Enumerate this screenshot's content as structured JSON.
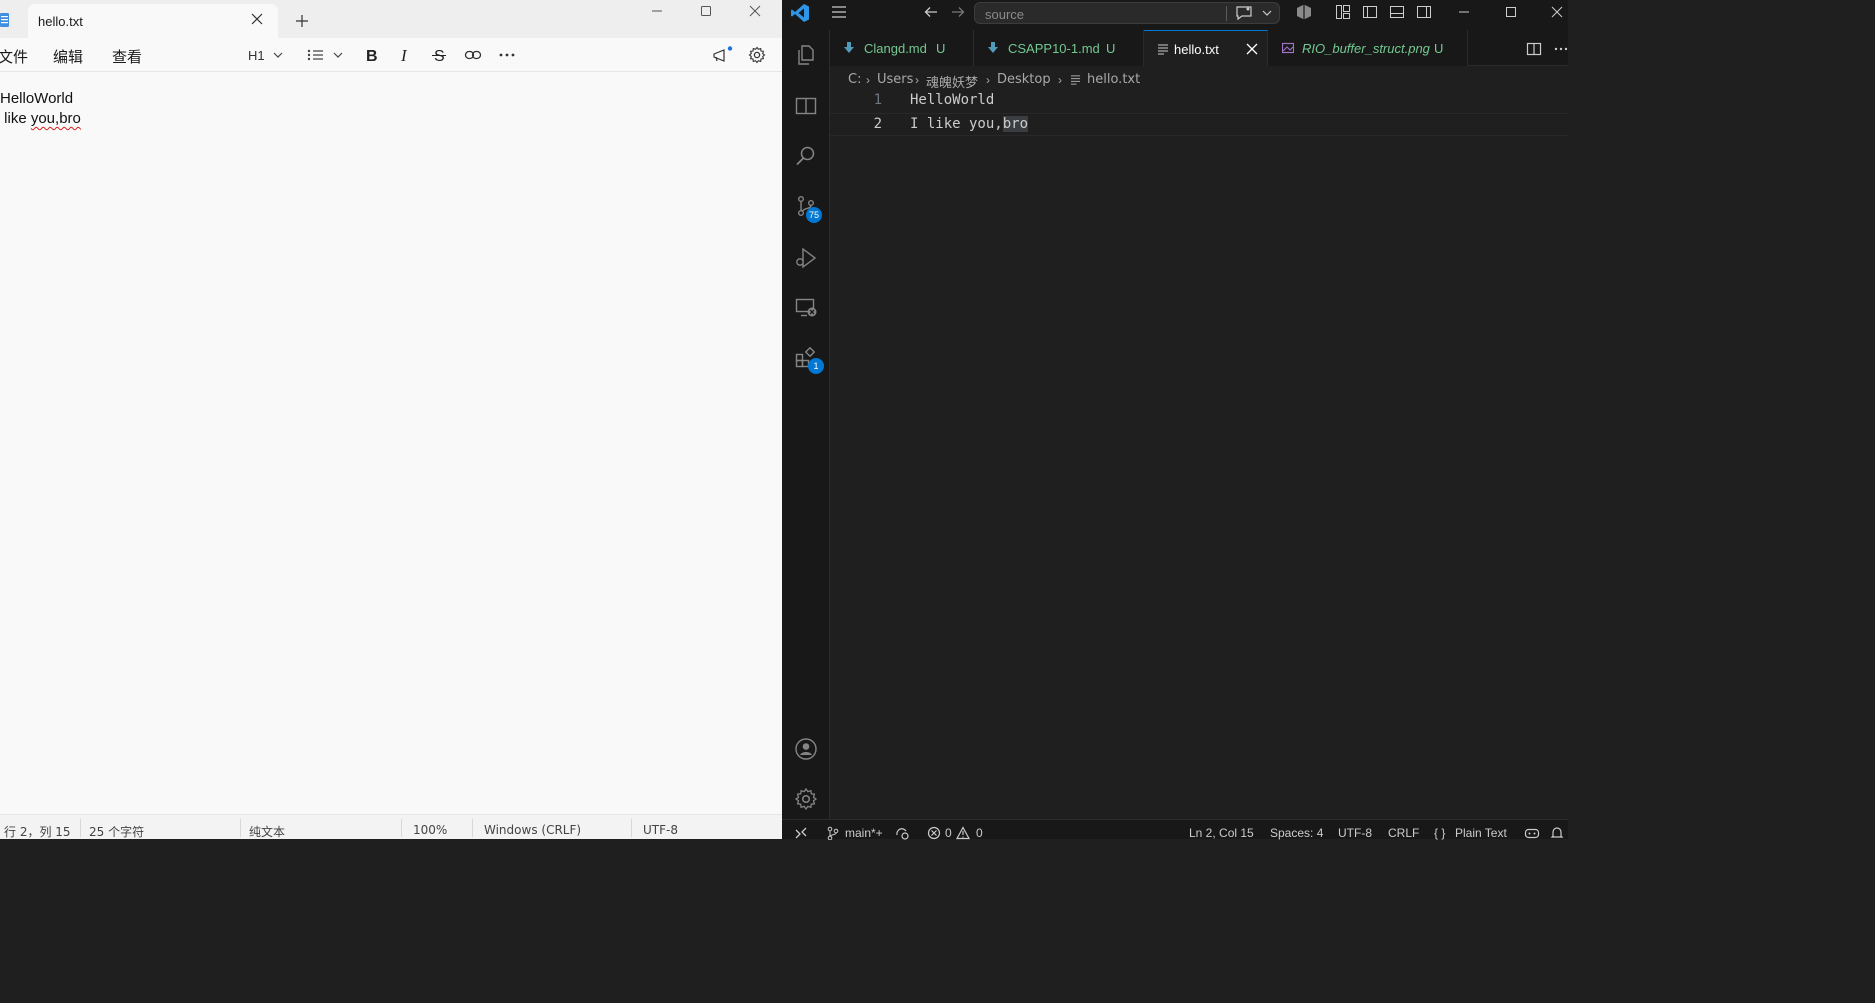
{
  "notepad": {
    "tab_title": "hello.txt",
    "menu": [
      "文件",
      "编辑",
      "查看"
    ],
    "heading_label": "H1",
    "content_lines": [
      "HelloWorld",
      " like ",
      "you,bro"
    ],
    "status": {
      "position": "行 2，列 15",
      "char_count": "25 个字符",
      "format": "纯文本",
      "zoom": "100%",
      "line_ending": "Windows (CRLF)",
      "encoding": "UTF-8"
    }
  },
  "vscode": {
    "search_placeholder": "source",
    "tabs": [
      {
        "label": "Clangd.md",
        "status": "U",
        "color": "#73c991"
      },
      {
        "label": "CSAPP10-1.md",
        "status": "U",
        "color": "#73c991"
      },
      {
        "label": "hello.txt",
        "status": "",
        "color": "#ffffff"
      },
      {
        "label": "RIO_buffer_struct.png",
        "status": "U",
        "color": "#73c991"
      }
    ],
    "breadcrumb": [
      "C:",
      "Users",
      "魂魄妖梦",
      "Desktop",
      "hello.txt"
    ],
    "lines": [
      {
        "number": "1",
        "text": "HelloWorld"
      },
      {
        "number": "2",
        "text": "I like you,",
        "selected": "bro"
      }
    ],
    "badges": {
      "source_control": "75",
      "extensions": "1"
    },
    "status": {
      "branch": "main*+",
      "problems": "0",
      "warnings": "0",
      "cursor": "Ln 2, Col 15",
      "spaces": "Spaces: 4",
      "encoding": "UTF-8",
      "eol": "CRLF",
      "language": "Plain Text"
    },
    "colors": {
      "accent": "#0078d4",
      "untracked": "#73c991"
    }
  }
}
